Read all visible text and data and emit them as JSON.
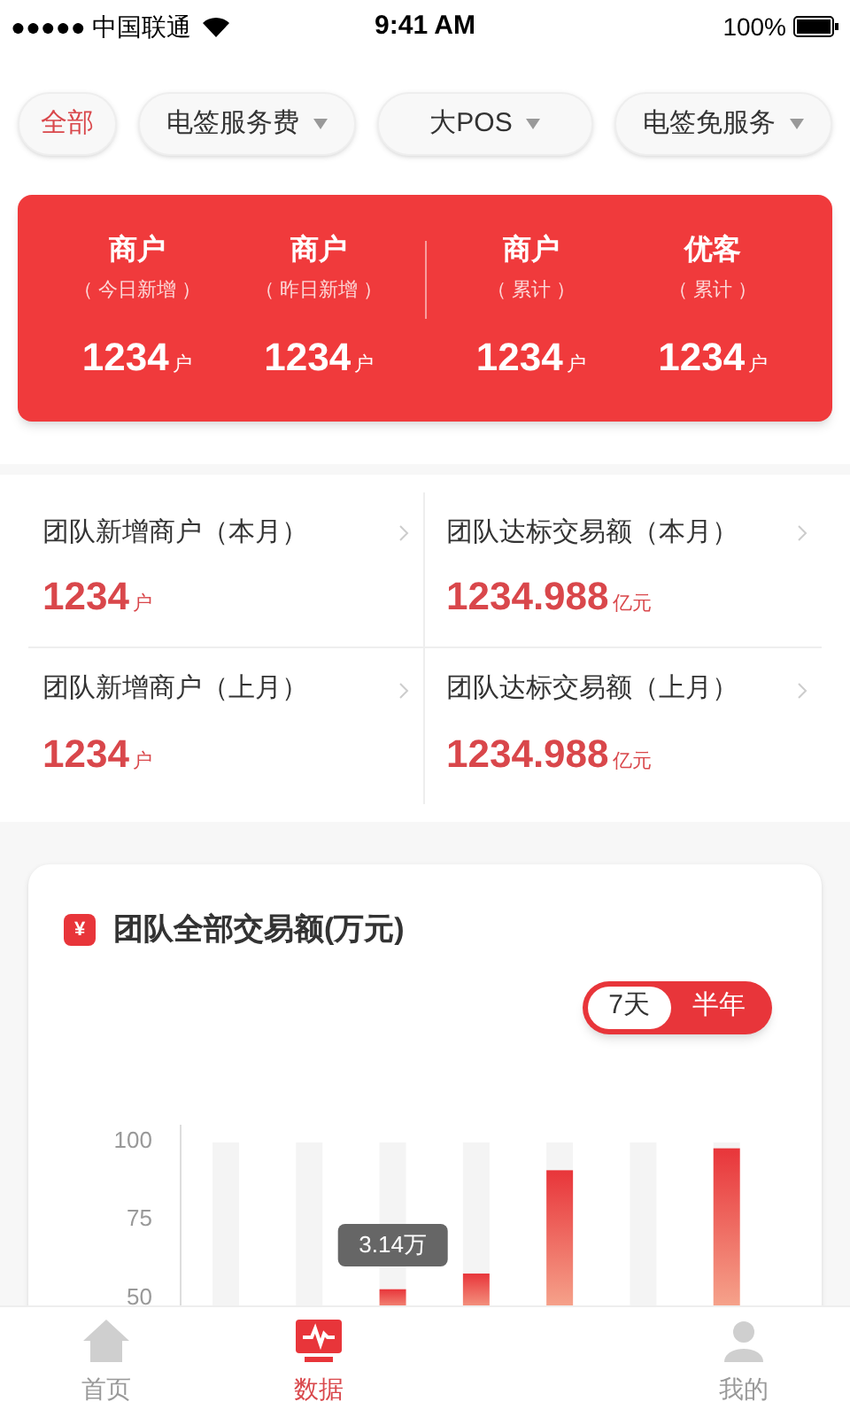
{
  "status_bar": {
    "carrier": "●●●●● 中国联通",
    "time": "9:41 AM",
    "battery": "100%"
  },
  "filters": [
    {
      "label": "全部",
      "selected": true,
      "dropdown": false
    },
    {
      "label": "电签服务费",
      "selected": false,
      "dropdown": true
    },
    {
      "label": "大POS",
      "selected": false,
      "dropdown": true
    },
    {
      "label": "电签免服务",
      "selected": false,
      "dropdown": true
    }
  ],
  "summary": [
    {
      "title": "商户",
      "subtitle": "（ 今日新增 ）",
      "value": "1234",
      "unit": "户"
    },
    {
      "title": "商户",
      "subtitle": "（ 昨日新增 ）",
      "value": "1234",
      "unit": "户"
    },
    {
      "title": "商户",
      "subtitle": "（ 累计 ）",
      "value": "1234",
      "unit": "户"
    },
    {
      "title": "优客",
      "subtitle": "（ 累计 ）",
      "value": "1234",
      "unit": "户"
    }
  ],
  "stats": [
    {
      "label": "团队新增商户（本月）",
      "value": "1234",
      "unit": "户"
    },
    {
      "label": "团队达标交易额（本月）",
      "value": "1234.988",
      "unit": "亿元"
    },
    {
      "label": "团队新增商户（上月）",
      "value": "1234",
      "unit": "户"
    },
    {
      "label": "团队达标交易额（上月）",
      "value": "1234.988",
      "unit": "亿元"
    }
  ],
  "chart_card": {
    "icon": "¥",
    "title": "团队全部交易额(万元)",
    "ranges": [
      {
        "label": "7天",
        "selected": true
      },
      {
        "label": "半年",
        "selected": false
      }
    ],
    "tooltip": "3.14万",
    "axis_labels": [
      "100",
      "75",
      "50"
    ]
  },
  "tab_bar": [
    {
      "label": "首页",
      "selected": false
    },
    {
      "label": "数据",
      "selected": true
    },
    {
      "label": "我的",
      "selected": false
    }
  ]
}
